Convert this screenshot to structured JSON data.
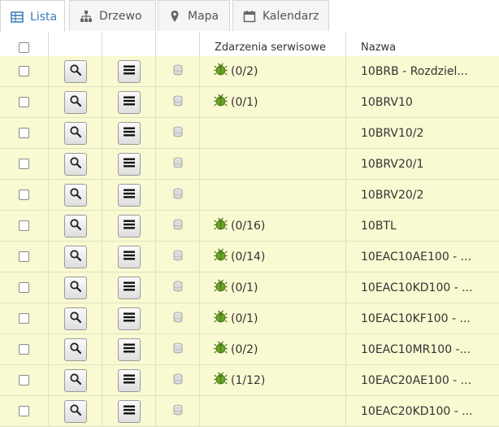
{
  "tabs": [
    {
      "label": "Lista",
      "icon": "table-icon",
      "active": true
    },
    {
      "label": "Drzewo",
      "icon": "sitemap-icon",
      "active": false
    },
    {
      "label": "Mapa",
      "icon": "map-marker-icon",
      "active": false
    },
    {
      "label": "Kalendarz",
      "icon": "calendar-icon",
      "active": false
    }
  ],
  "table": {
    "headers": {
      "events": "Zdarzenia serwisowe",
      "name": "Nazwa"
    },
    "rows": [
      {
        "events": "(0/2)",
        "name": "10BRB - Rozdziel..."
      },
      {
        "events": "(0/1)",
        "name": "10BRV10"
      },
      {
        "events": "",
        "name": "10BRV10/2"
      },
      {
        "events": "",
        "name": "10BRV20/1"
      },
      {
        "events": "",
        "name": "10BRV20/2"
      },
      {
        "events": "(0/16)",
        "name": "10BTL"
      },
      {
        "events": "(0/14)",
        "name": "10EAC10AE100 - ..."
      },
      {
        "events": "(0/1)",
        "name": "10EAC10KD100 - ..."
      },
      {
        "events": "(0/1)",
        "name": "10EAC10KF100 - ..."
      },
      {
        "events": "(0/2)",
        "name": "10EAC10MR100 -..."
      },
      {
        "events": "(1/12)",
        "name": "10EAC20AE100 - ..."
      },
      {
        "events": "",
        "name": "10EAC20KD100 - ..."
      }
    ]
  },
  "colors": {
    "row_bg": "#f9f9d2",
    "active_tab": "#3a7ab8",
    "bug_green": "#5a8f1e"
  }
}
